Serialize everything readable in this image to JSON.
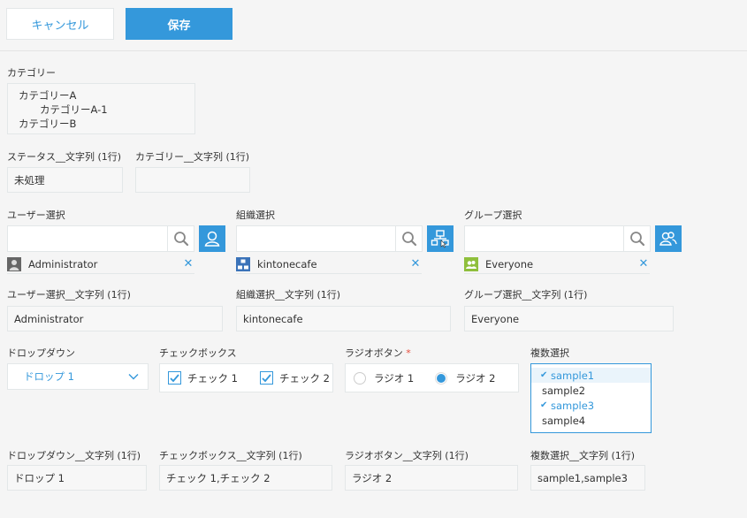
{
  "toolbar": {
    "cancel_label": "キャンセル",
    "save_label": "保存"
  },
  "category": {
    "label": "カテゴリー",
    "items": [
      {
        "text": "カテゴリーA",
        "indent": 0
      },
      {
        "text": "カテゴリーA-1",
        "indent": 1
      },
      {
        "text": "カテゴリーB",
        "indent": 0
      }
    ]
  },
  "status_text": {
    "label": "ステータス__文字列 (1行)",
    "value": "未処理"
  },
  "category_text": {
    "label": "カテゴリー__文字列 (1行)",
    "value": ""
  },
  "user_select": {
    "label": "ユーザー選択",
    "entity": "Administrator"
  },
  "org_select": {
    "label": "組織選択",
    "entity": "kintonecafe"
  },
  "group_select": {
    "label": "グループ選択",
    "entity": "Everyone"
  },
  "user_text": {
    "label": "ユーザー選択__文字列 (1行)",
    "value": "Administrator"
  },
  "org_text": {
    "label": "組織選択__文字列 (1行)",
    "value": "kintonecafe"
  },
  "group_text": {
    "label": "グループ選択__文字列 (1行)",
    "value": "Everyone"
  },
  "dropdown": {
    "label": "ドロップダウン",
    "value": "ドロップ 1"
  },
  "checkbox": {
    "label": "チェックボックス",
    "options": [
      {
        "label": "チェック 1",
        "checked": true
      },
      {
        "label": "チェック 2",
        "checked": true
      }
    ]
  },
  "radio": {
    "label": "ラジオボタン",
    "required_mark": "*",
    "options": [
      {
        "label": "ラジオ 1",
        "selected": false
      },
      {
        "label": "ラジオ 2",
        "selected": true
      }
    ]
  },
  "multi": {
    "label": "複数選択",
    "options": [
      {
        "label": "sample1",
        "selected": true
      },
      {
        "label": "sample2",
        "selected": false
      },
      {
        "label": "sample3",
        "selected": true
      },
      {
        "label": "sample4",
        "selected": false
      }
    ]
  },
  "dropdown_text": {
    "label": "ドロップダウン__文字列 (1行)",
    "value": "ドロップ 1"
  },
  "checkbox_text": {
    "label": "チェックボックス__文字列 (1行)",
    "value": "チェック 1,チェック 2"
  },
  "radio_text": {
    "label": "ラジオボタン__文字列 (1行)",
    "value": "ラジオ 2"
  },
  "multi_text": {
    "label": "複数選択__文字列 (1行)",
    "value": "sample1,sample3"
  },
  "colors": {
    "accent": "#3498db",
    "required": "#e74c3c",
    "field_bg": "#f7f7f7",
    "border": "#e3e7e8"
  },
  "icons": {
    "search": "search-icon",
    "user_picker": "user-icon",
    "org_picker": "organization-icon",
    "group_picker": "group-icon",
    "remove": "close-icon",
    "dropdown": "chevron-down-icon",
    "check": "check-icon"
  }
}
